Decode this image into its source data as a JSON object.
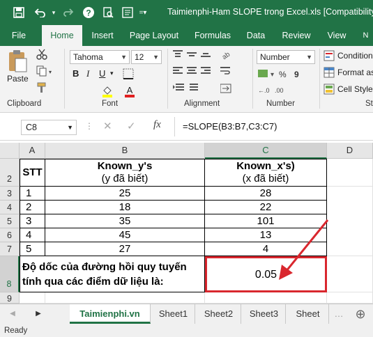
{
  "window": {
    "title": "Taimienphi-Ham SLOPE trong Excel.xls  [Compatibility M"
  },
  "ribbon_tabs": [
    "File",
    "Home",
    "Insert",
    "Page Layout",
    "Formulas",
    "Data",
    "Review",
    "View"
  ],
  "ribbon": {
    "paste_label": "Paste",
    "font_name": "Tahoma",
    "font_size": "12",
    "number_format": "Number",
    "conditional": "Condition",
    "format_as": "Format as",
    "cell_styles": "Cell Styles",
    "groups": [
      "Clipboard",
      "Font",
      "Alignment",
      "Number",
      "St"
    ]
  },
  "formula_bar": {
    "name_box": "C8",
    "fx": "fx",
    "formula": "=SLOPE(B3:B7,C3:C7)"
  },
  "columns": [
    "A",
    "B",
    "C",
    "D"
  ],
  "rows": [
    "1",
    "2",
    "3",
    "4",
    "5",
    "6",
    "7",
    "8",
    "9"
  ],
  "table": {
    "header_a": "STT",
    "header_b1": "Known_y's",
    "header_b2": "(y đã biết)",
    "header_c1": "Known_x's)",
    "header_c2": "(x đã biết)",
    "data": [
      {
        "stt": "1",
        "y": "25",
        "x": "28"
      },
      {
        "stt": "2",
        "y": "18",
        "x": "22"
      },
      {
        "stt": "3",
        "y": "35",
        "x": "101"
      },
      {
        "stt": "4",
        "y": "45",
        "x": "13"
      },
      {
        "stt": "5",
        "y": "27",
        "x": "4"
      }
    ],
    "slope_label_1": "Độ dốc của đường hồi quy tuyến",
    "slope_label_2": "tính qua các điểm dữ liệu là:",
    "slope_value": "0.05"
  },
  "sheets": [
    "Taimienphi.vn",
    "Sheet1",
    "Sheet2",
    "Sheet3",
    "Sheet"
  ],
  "status": "Ready",
  "colors": {
    "excel_green": "#217346",
    "highlight": "#d9272e"
  }
}
